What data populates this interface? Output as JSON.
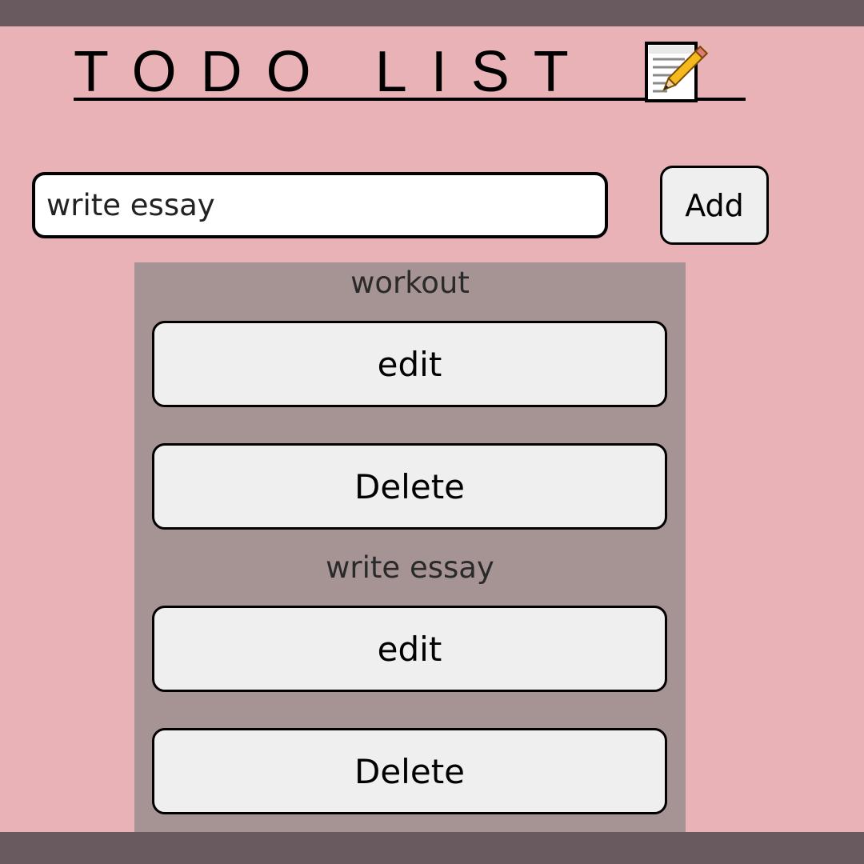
{
  "header": {
    "title": "TODO LIST",
    "title_icon": "memo-icon"
  },
  "form": {
    "input_value": "write essay",
    "add_label": "Add"
  },
  "todos": [
    {
      "text": "workout",
      "edit_label": "edit",
      "delete_label": "Delete"
    },
    {
      "text": "write essay",
      "edit_label": "edit",
      "delete_label": "Delete"
    }
  ],
  "colors": {
    "page_background": "#e8b2b6",
    "bar": "#685a5e",
    "panel": "#a69393",
    "button": "#efefef"
  }
}
